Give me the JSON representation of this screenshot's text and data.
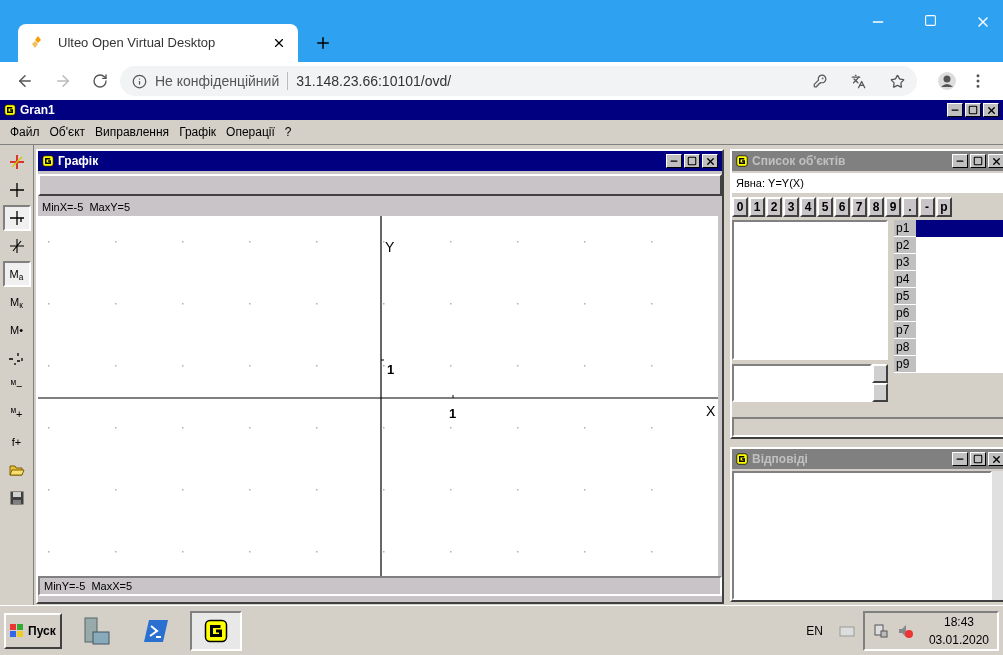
{
  "browser": {
    "tab_title": "Ulteo Open Virtual Desktop",
    "security": "Не конфіденційний",
    "url": "31.148.23.66:10101/ovd/"
  },
  "app": {
    "title": "Gran1",
    "menu": [
      "Файл",
      "Об'єкт",
      "Виправлення",
      "Графік",
      "Операції",
      "?"
    ]
  },
  "toolbar": [
    {
      "kind": "axes",
      "selected": false
    },
    {
      "kind": "cross",
      "selected": false
    },
    {
      "kind": "cross-stub",
      "selected": true
    },
    {
      "kind": "cross-slant",
      "selected": false
    },
    {
      "kind": "text",
      "label": "M$_{а}$",
      "selected": true
    },
    {
      "kind": "text",
      "label": "M$_{к}$",
      "selected": false
    },
    {
      "kind": "text",
      "label": "M•",
      "selected": false
    },
    {
      "kind": "scale",
      "selected": false
    },
    {
      "kind": "text",
      "label": "$^{м}$−",
      "selected": false
    },
    {
      "kind": "text",
      "label": "$^{м}$+",
      "selected": false
    },
    {
      "kind": "text",
      "label": "f+",
      "selected": false
    },
    {
      "kind": "folder",
      "selected": false
    },
    {
      "kind": "save",
      "selected": false
    }
  ],
  "graph_window": {
    "title": "Графік",
    "active": true,
    "top_range": "MinX=-5  MaxY=5",
    "bottom_range": "MinY=-5  MaxX=5",
    "y_axis_label": "Y",
    "x_axis_label": "X",
    "y_tick_label": "1",
    "x_tick_label": "1"
  },
  "objects_window": {
    "title": "Список об'єктів",
    "active": false,
    "formula": "Явна: Y=Y(X)",
    "keys": [
      "0",
      "1",
      "2",
      "3",
      "4",
      "5",
      "6",
      "7",
      "8",
      "9",
      ".",
      "-",
      "p"
    ],
    "params": [
      {
        "label": "p1",
        "selected": true
      },
      {
        "label": "p2",
        "selected": false
      },
      {
        "label": "p3",
        "selected": false
      },
      {
        "label": "p4",
        "selected": false
      },
      {
        "label": "p5",
        "selected": false
      },
      {
        "label": "p6",
        "selected": false
      },
      {
        "label": "p7",
        "selected": false
      },
      {
        "label": "p8",
        "selected": false
      },
      {
        "label": "p9",
        "selected": false
      }
    ]
  },
  "answers_window": {
    "title": "Відповіді",
    "active": false
  },
  "taskbar": {
    "start": "Пуск",
    "apps": [
      {
        "kind": "server",
        "selected": false
      },
      {
        "kind": "shell",
        "selected": false
      },
      {
        "kind": "gran",
        "selected": true
      }
    ],
    "language": "EN",
    "time": "18:43",
    "date": "03.01.2020"
  }
}
